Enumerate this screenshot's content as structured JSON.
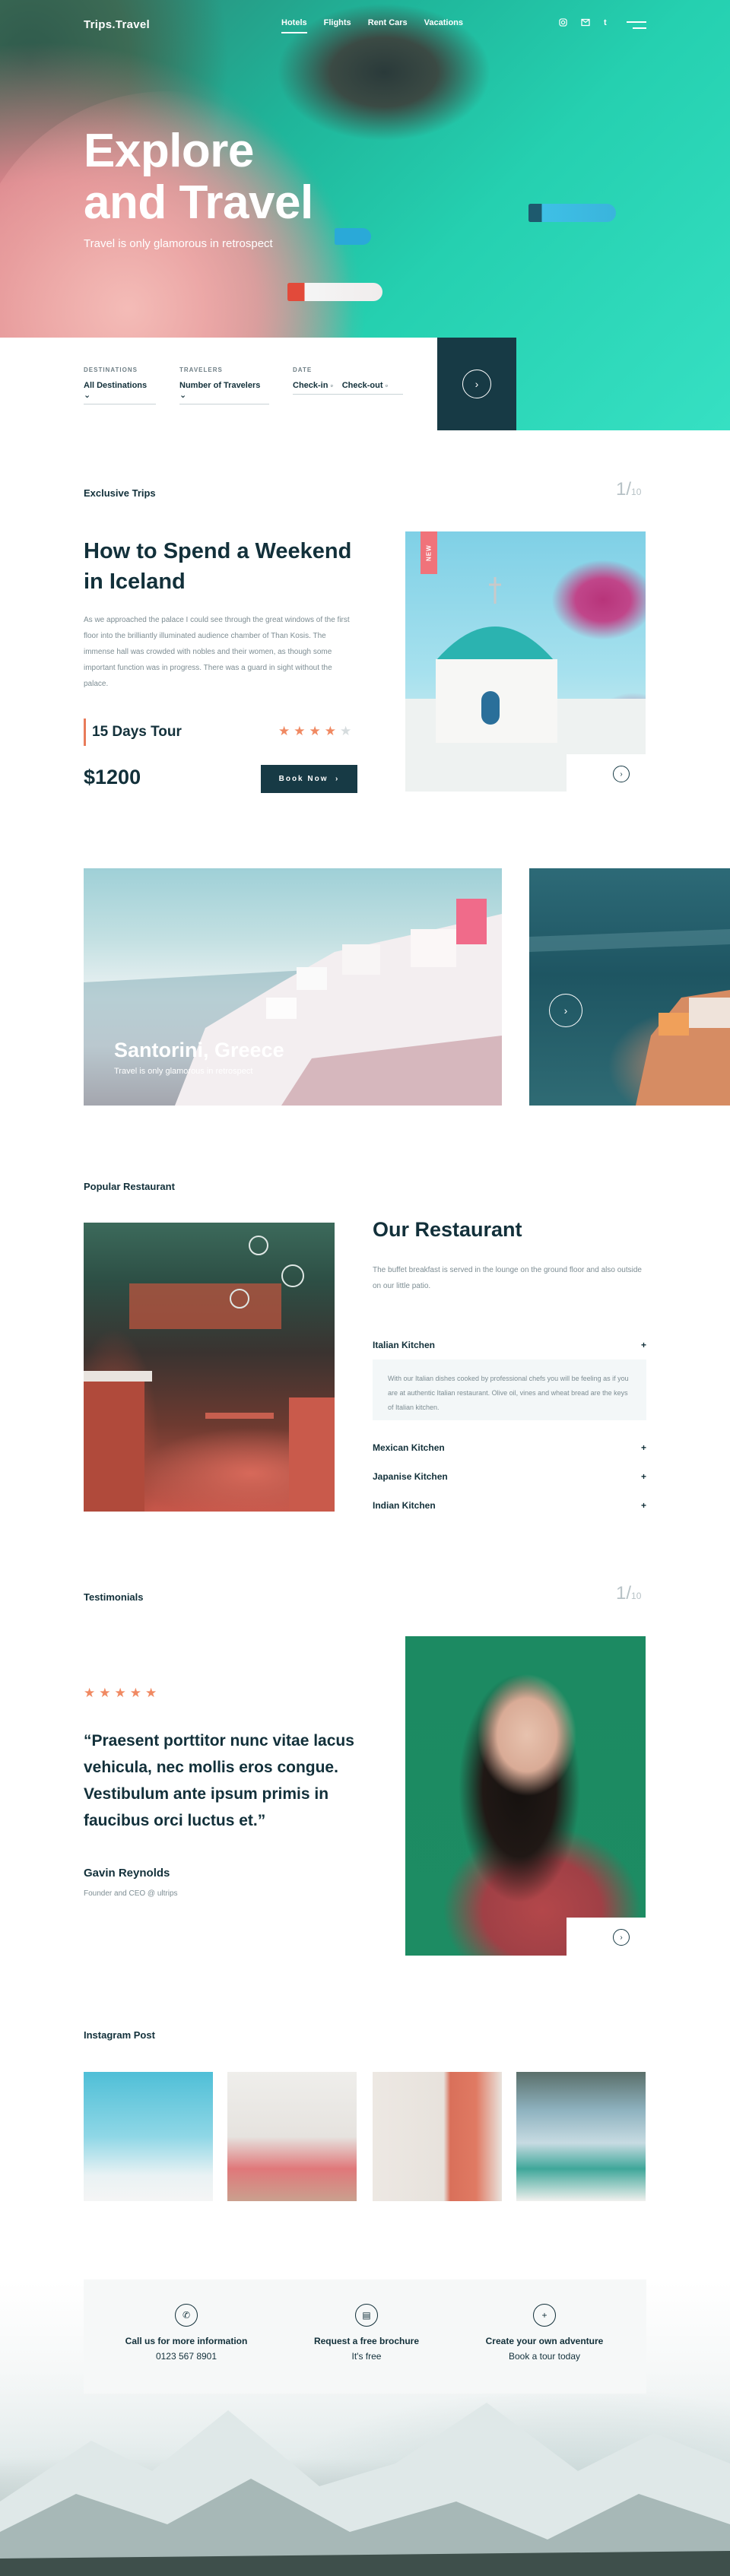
{
  "nav": {
    "logo": "Trips.Travel",
    "links": [
      "Hotels",
      "Flights",
      "Rent Cars",
      "Vacations"
    ],
    "social": [
      "instagram-icon",
      "mail-icon",
      "tumblr-icon"
    ]
  },
  "hero": {
    "title_line1": "Explore",
    "title_line2": "and Travel",
    "subtitle": "Travel is only glamorous in retrospect"
  },
  "search": {
    "destinations_label": "DESTINATIONS",
    "destinations_value": "All Destinations",
    "travelers_label": "TRAVELERS",
    "travelers_value": "Number of Travelers",
    "date_label": "DATE",
    "checkin": "Check-in",
    "checkout": "Check-out"
  },
  "exclusive": {
    "label": "Exclusive Trips",
    "counter_current": "1",
    "counter_total": "10",
    "title_line1": "How to Spend a Weekend",
    "title_line2": "in Iceland",
    "text": "As we approached the palace I could see through the great windows of the first floor into the brilliantly illuminated audience chamber of Than Kosis. The immense hall was crowded with nobles and their women, as though some important function was in progress. There was a guard in sight without the palace.",
    "days": "15 Days Tour",
    "rating": 4,
    "rating_max": 5,
    "price": "$1200",
    "book_label": "Book Now",
    "badge": "NEW"
  },
  "destination": {
    "title": "Santorini, Greece",
    "subtitle": "Travel is only glamorous in retrospect"
  },
  "restaurant": {
    "label": "Popular Restaurant",
    "title": "Our Restaurant",
    "text": "The buffet breakfast is served in the lounge on the ground floor and also outside on our little patio.",
    "items": [
      {
        "label": "Italian Kitchen",
        "body": "With our Italian dishes cooked by professional chefs you will be feeling as if you are at authentic Italian restaurant. Olive oil, vines and wheat bread are the keys of Italian kitchen."
      },
      {
        "label": "Mexican Kitchen"
      },
      {
        "label": "Japanise Kitchen"
      },
      {
        "label": "Indian Kitchen"
      }
    ]
  },
  "testimonials": {
    "label": "Testimonials",
    "counter_current": "1",
    "counter_total": "10",
    "rating": 5,
    "quote": "“Praesent porttitor nunc vitae lacus vehicula, nec mollis eros congue. Vestibulum ante ipsum primis in faucibus orci luctus et.”",
    "author": "Gavin Reynolds",
    "role": "Founder and CEO @ ultrips"
  },
  "instagram": {
    "label": "Instagram Post"
  },
  "cta": [
    {
      "icon": "phone-icon",
      "title": "Call us for more information",
      "sub": "0123 567 8901"
    },
    {
      "icon": "brochure-icon",
      "title": "Request a free brochure",
      "sub": "It's free"
    },
    {
      "icon": "plus-icon",
      "title": "Create your own adventure",
      "sub": "Book a tour today"
    }
  ],
  "colors": {
    "primary": "#173a45",
    "accent": "#f08962",
    "badge": "#f0737a"
  }
}
